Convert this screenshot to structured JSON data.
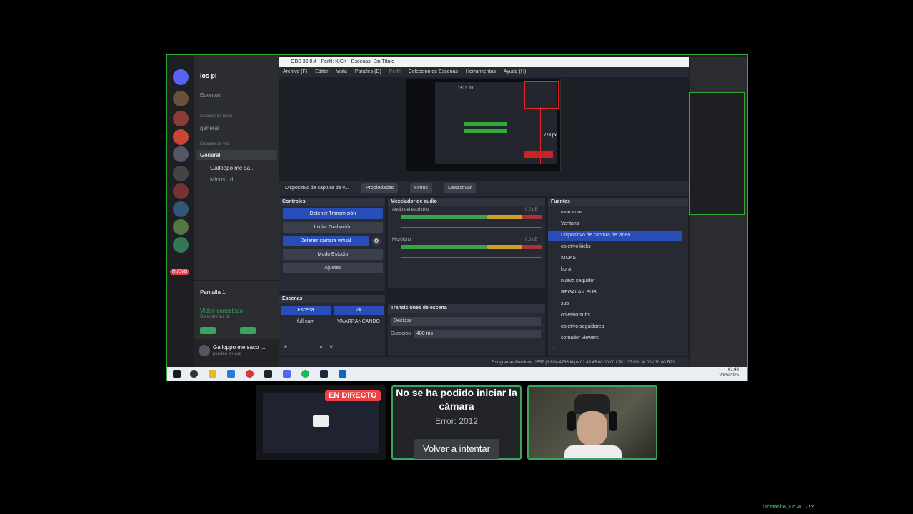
{
  "discord": {
    "server_name": "los pl",
    "events": "Eventos",
    "text_channels_header": "Canales de texto",
    "channel_general_text": "general",
    "voice_channels_header": "Canales de voz",
    "voice_general": "General",
    "voice_users": [
      "Galloppo me sa...",
      "Minos...d"
    ],
    "new_badge": "NUEVO",
    "screen_name": "Pantalla 1",
    "video_connected": "Vídeo conectado",
    "video_connected_sub": "General / los pl",
    "user_name": "Galloppo me saco ...",
    "user_status": "pueden en voz"
  },
  "obs": {
    "title": "OBS 32.0.4 - Perfil: KICK - Escenas: Sin Título",
    "menu": [
      "Archivo (F)",
      "Editar",
      "Vista",
      "Paneles (D)",
      "Perfil",
      "Colección de Escenas",
      "Herramientas",
      "Ayuda (H)"
    ],
    "preview_label_w": "1513 px",
    "preview_label_h": "773 px",
    "prop_source": "Dispositivo de captura de v...",
    "prop_buttons": [
      "Propiedades",
      "Filtros",
      "Desactivar"
    ],
    "controls_title": "Controles",
    "controls": [
      "Detener Transmisión",
      "Iniciar Grabación",
      "Detener cámara virtual",
      "Modo Estudio",
      "Ajustes"
    ],
    "mixer_title": "Mezclador de audio",
    "mixer_tracks": [
      {
        "name": "Audio del escritorio",
        "db": "0.0 dB"
      },
      {
        "name": "Micrófono",
        "db": "0.0 dB"
      }
    ],
    "scenes_title": "Escenas",
    "scenes": [
      "Escena",
      "2k",
      "full cam",
      "VA ARRANCANDO"
    ],
    "transitions_title": "Transiciones de escena",
    "transition_value": "Deslizar",
    "duration_label": "Duración",
    "duration_value": "480 ms",
    "sources_title": "Fuentes",
    "sources": [
      "marcador",
      "Ventana",
      "Dispositivo de captura de video",
      "objetivo kicks",
      "KICKS",
      "hora",
      "nuevo seguidor",
      "REGALAN SUB",
      "sub",
      "objetivo subs",
      "objetivo seguidores",
      "contador viewers"
    ],
    "status": "Fotogramas Perdidos: 1557 (3.8%)   4765 kbps   01:49:45   00:00:00   CPU: 37.0%   30.00 / 30.00 FPS"
  },
  "taskbar": {
    "time": "01:48",
    "date": "21/5/2025"
  },
  "tiles": {
    "live_badge": "EN DIRECTO",
    "camera_error_title": "No se ha podido iniciar la cámara",
    "camera_error_code": "Error: 2012",
    "retry_button": "Volver a intentar"
  },
  "viewer_tag": {
    "name": "Dostasho_12",
    "value": ": 20177?"
  }
}
